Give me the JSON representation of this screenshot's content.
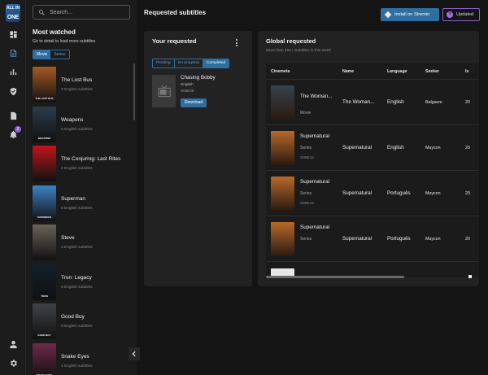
{
  "logo": {
    "top": "ALL IN",
    "bottom": "ONE"
  },
  "rail": {
    "items": [
      "dashboard-icon",
      "subtitles-icon",
      "chart-icon",
      "shield-icon",
      "document-icon",
      "bell-icon",
      "user-icon",
      "gear-icon"
    ],
    "active": "subtitles-icon",
    "bell_badge": "2"
  },
  "sidebar": {
    "search_placeholder": "Search...",
    "title": "Most watched",
    "subtitle": "Go to detail to load more subtitles",
    "segments": [
      "Movie",
      "Series"
    ],
    "selected_segment": "Movie",
    "movies": [
      {
        "title": "The Lost Bus",
        "subs": "2 English subtitles",
        "poster_color": "#a65a23",
        "poster_text": "THE LOST BUS"
      },
      {
        "title": "Weapons",
        "subs": "5 English subtitles",
        "poster_color": "#2b3c4c",
        "poster_text": "WEAPONS"
      },
      {
        "title": "The Conjuring: Last Rites",
        "subs": "4 English subtitles",
        "poster_color": "#c2141b",
        "poster_text": ""
      },
      {
        "title": "Superman",
        "subs": "5 English subtitles",
        "poster_color": "#3d82c4",
        "poster_text": "SUPERMAN"
      },
      {
        "title": "Steve",
        "subs": "2 English subtitles",
        "poster_color": "#6a6259",
        "poster_text": ""
      },
      {
        "title": "Tron: Legacy",
        "subs": "6 English subtitles",
        "poster_color": "#10202c",
        "poster_text": "TRON"
      },
      {
        "title": "Good Boy",
        "subs": "0 English subtitles",
        "poster_color": "#3f4348",
        "poster_text": "GOOD BOY"
      },
      {
        "title": "Snake Eyes",
        "subs": "1 English subtitles",
        "poster_color": "#6d2a4a",
        "poster_text": "SNAKE EYES"
      }
    ]
  },
  "header": {
    "title": "Requested subtitles",
    "install_label": "Install on Stremio",
    "updated_label": "Updated",
    "updated_icon": "?"
  },
  "your_requested": {
    "title": "Your requested",
    "tabs": [
      "Pending",
      "On progress",
      "Completed"
    ],
    "selected_tab": "Completed",
    "item": {
      "title": "Chasing Bobby",
      "language": "English",
      "episode": "S05E09",
      "download_label": "Download"
    }
  },
  "global_requested": {
    "title": "Global requested",
    "subtitle": "More than 491+ Subtitles in this week",
    "columns": [
      "Cinemeta",
      "Name",
      "Language",
      "Seeker",
      "Is"
    ],
    "rows": [
      {
        "cinemeta_title": "The Woman...",
        "type": "Movie",
        "episode": "",
        "name": "The Woman...",
        "language": "English",
        "seeker": "Balgasm",
        "is": "20",
        "poster_color": "#35424e"
      },
      {
        "cinemeta_title": "Supernatural",
        "type": "Series",
        "episode": "S06E12",
        "name": "Supernatural",
        "language": "English",
        "seeker": "Maycon",
        "is": "20",
        "poster_color": "#b8692a"
      },
      {
        "cinemeta_title": "Supernatural",
        "type": "Series",
        "episode": "S06E12",
        "name": "Supernatural",
        "language": "Português",
        "seeker": "Maycon",
        "is": "20",
        "poster_color": "#b8692a"
      },
      {
        "cinemeta_title": "Supernatural",
        "type": "Series",
        "episode": "",
        "name": "Supernatural",
        "language": "Português",
        "seeker": "Maycon",
        "is": "20",
        "poster_color": "#b8692a"
      }
    ]
  },
  "colors": {
    "accent": "#2f6f9f",
    "accent_text": "#5aa0e0",
    "badge": "#8e5fd0",
    "background": "#141414",
    "card": "#222222"
  }
}
